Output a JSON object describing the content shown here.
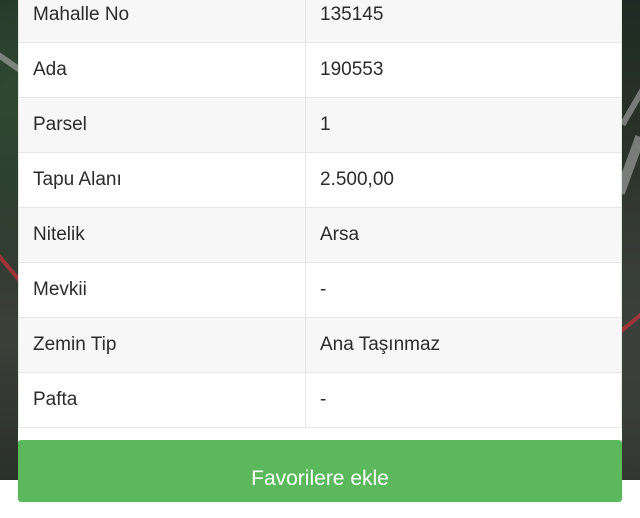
{
  "rows": [
    {
      "label": "Mahalle No",
      "value": "135145"
    },
    {
      "label": "Ada",
      "value": "190553"
    },
    {
      "label": "Parsel",
      "value": "1"
    },
    {
      "label": "Tapu Alanı",
      "value": "2.500,00"
    },
    {
      "label": "Nitelik",
      "value": "Arsa"
    },
    {
      "label": "Mevkii",
      "value": "-"
    },
    {
      "label": "Zemin Tip",
      "value": "Ana Taşınmaz"
    },
    {
      "label": "Pafta",
      "value": "-"
    }
  ],
  "actions": {
    "favorite_label": "Favorilere ekle"
  },
  "colors": {
    "button_green": "#5cb85c",
    "row_stripe": "#f7f7f7"
  }
}
